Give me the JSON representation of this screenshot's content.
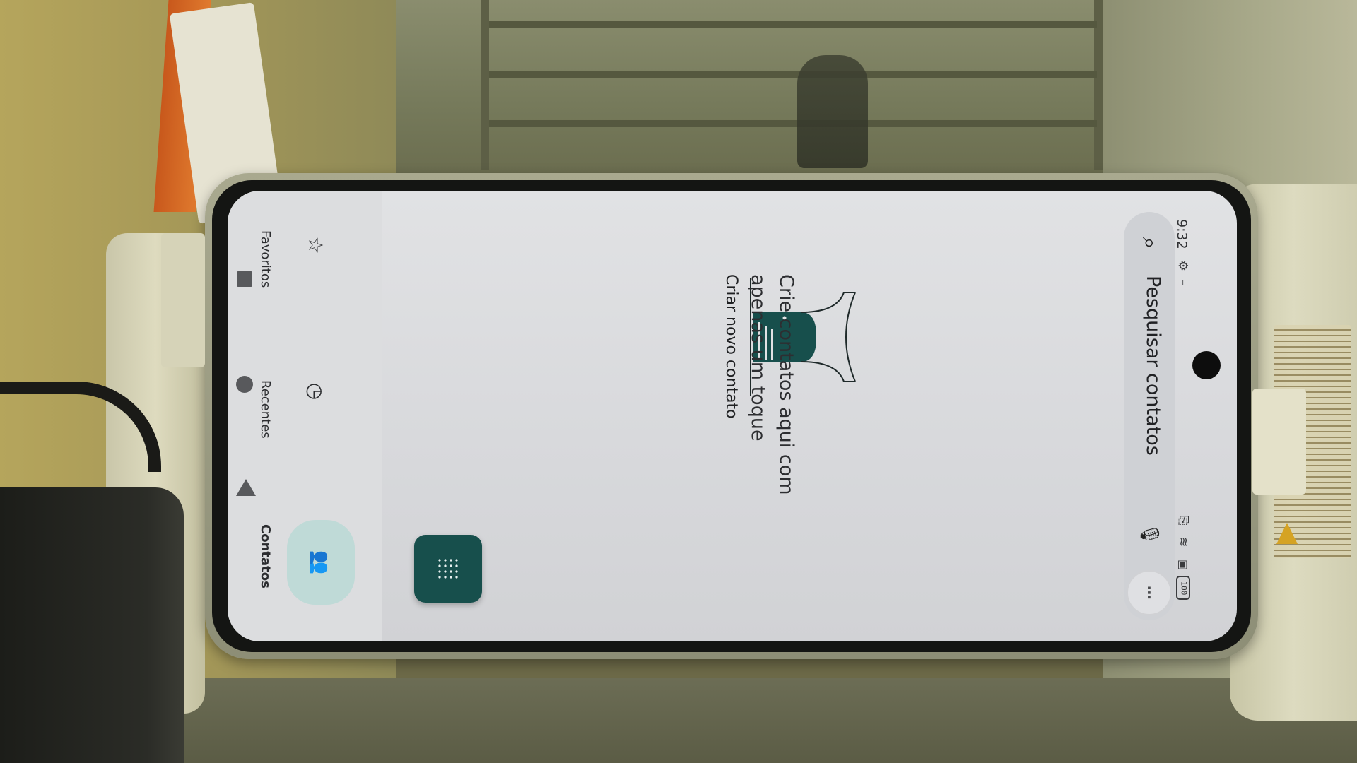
{
  "status_bar": {
    "time": "9:32",
    "battery": "100"
  },
  "search": {
    "placeholder": "Pesquisar contatos"
  },
  "empty_state": {
    "title_line1": "Crie contatos aqui com",
    "title_line2": "apenas um toque",
    "create_link": "Criar novo contato"
  },
  "nav": {
    "items": [
      {
        "label": "Favoritos",
        "icon": "star-icon"
      },
      {
        "label": "Recentes",
        "icon": "clock-icon"
      },
      {
        "label": "Contatos",
        "icon": "contacts-icon",
        "selected": true
      }
    ]
  },
  "colors": {
    "accent": "#174f4c",
    "nav_selected": "#bfdad7"
  }
}
